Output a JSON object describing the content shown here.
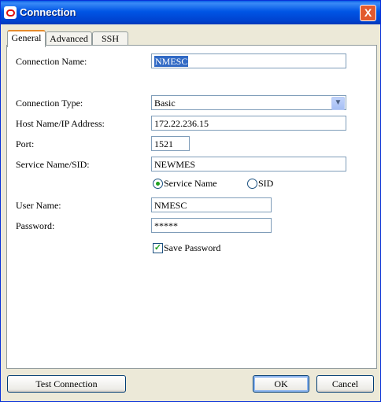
{
  "window": {
    "title": "Connection",
    "close_glyph": "X"
  },
  "tabs": [
    {
      "label": "General",
      "active": true
    },
    {
      "label": "Advanced",
      "active": false
    },
    {
      "label": "SSH",
      "active": false
    }
  ],
  "form": {
    "connection_name_label": "Connection Name:",
    "connection_name_value": "NMESC",
    "connection_type_label": "Connection Type:",
    "connection_type_value": "Basic",
    "host_label": "Host Name/IP Address:",
    "host_value": "172.22.236.15",
    "port_label": "Port:",
    "port_value": "1521",
    "service_label": "Service Name/SID:",
    "service_value": "NEWMES",
    "radio_service_name": "Service Name",
    "radio_sid": "SID",
    "radio_selected": "Service Name",
    "user_label": "User Name:",
    "user_value": "NMESC",
    "password_label": "Password:",
    "password_value": "*****",
    "save_password_label": "Save Password",
    "save_password_checked": true
  },
  "buttons": {
    "test_connection": "Test Connection",
    "ok": "OK",
    "cancel": "Cancel"
  },
  "colors": {
    "title_bar": "#0055E5",
    "selection": "#316AC5",
    "radio_dot": "#21A121"
  }
}
